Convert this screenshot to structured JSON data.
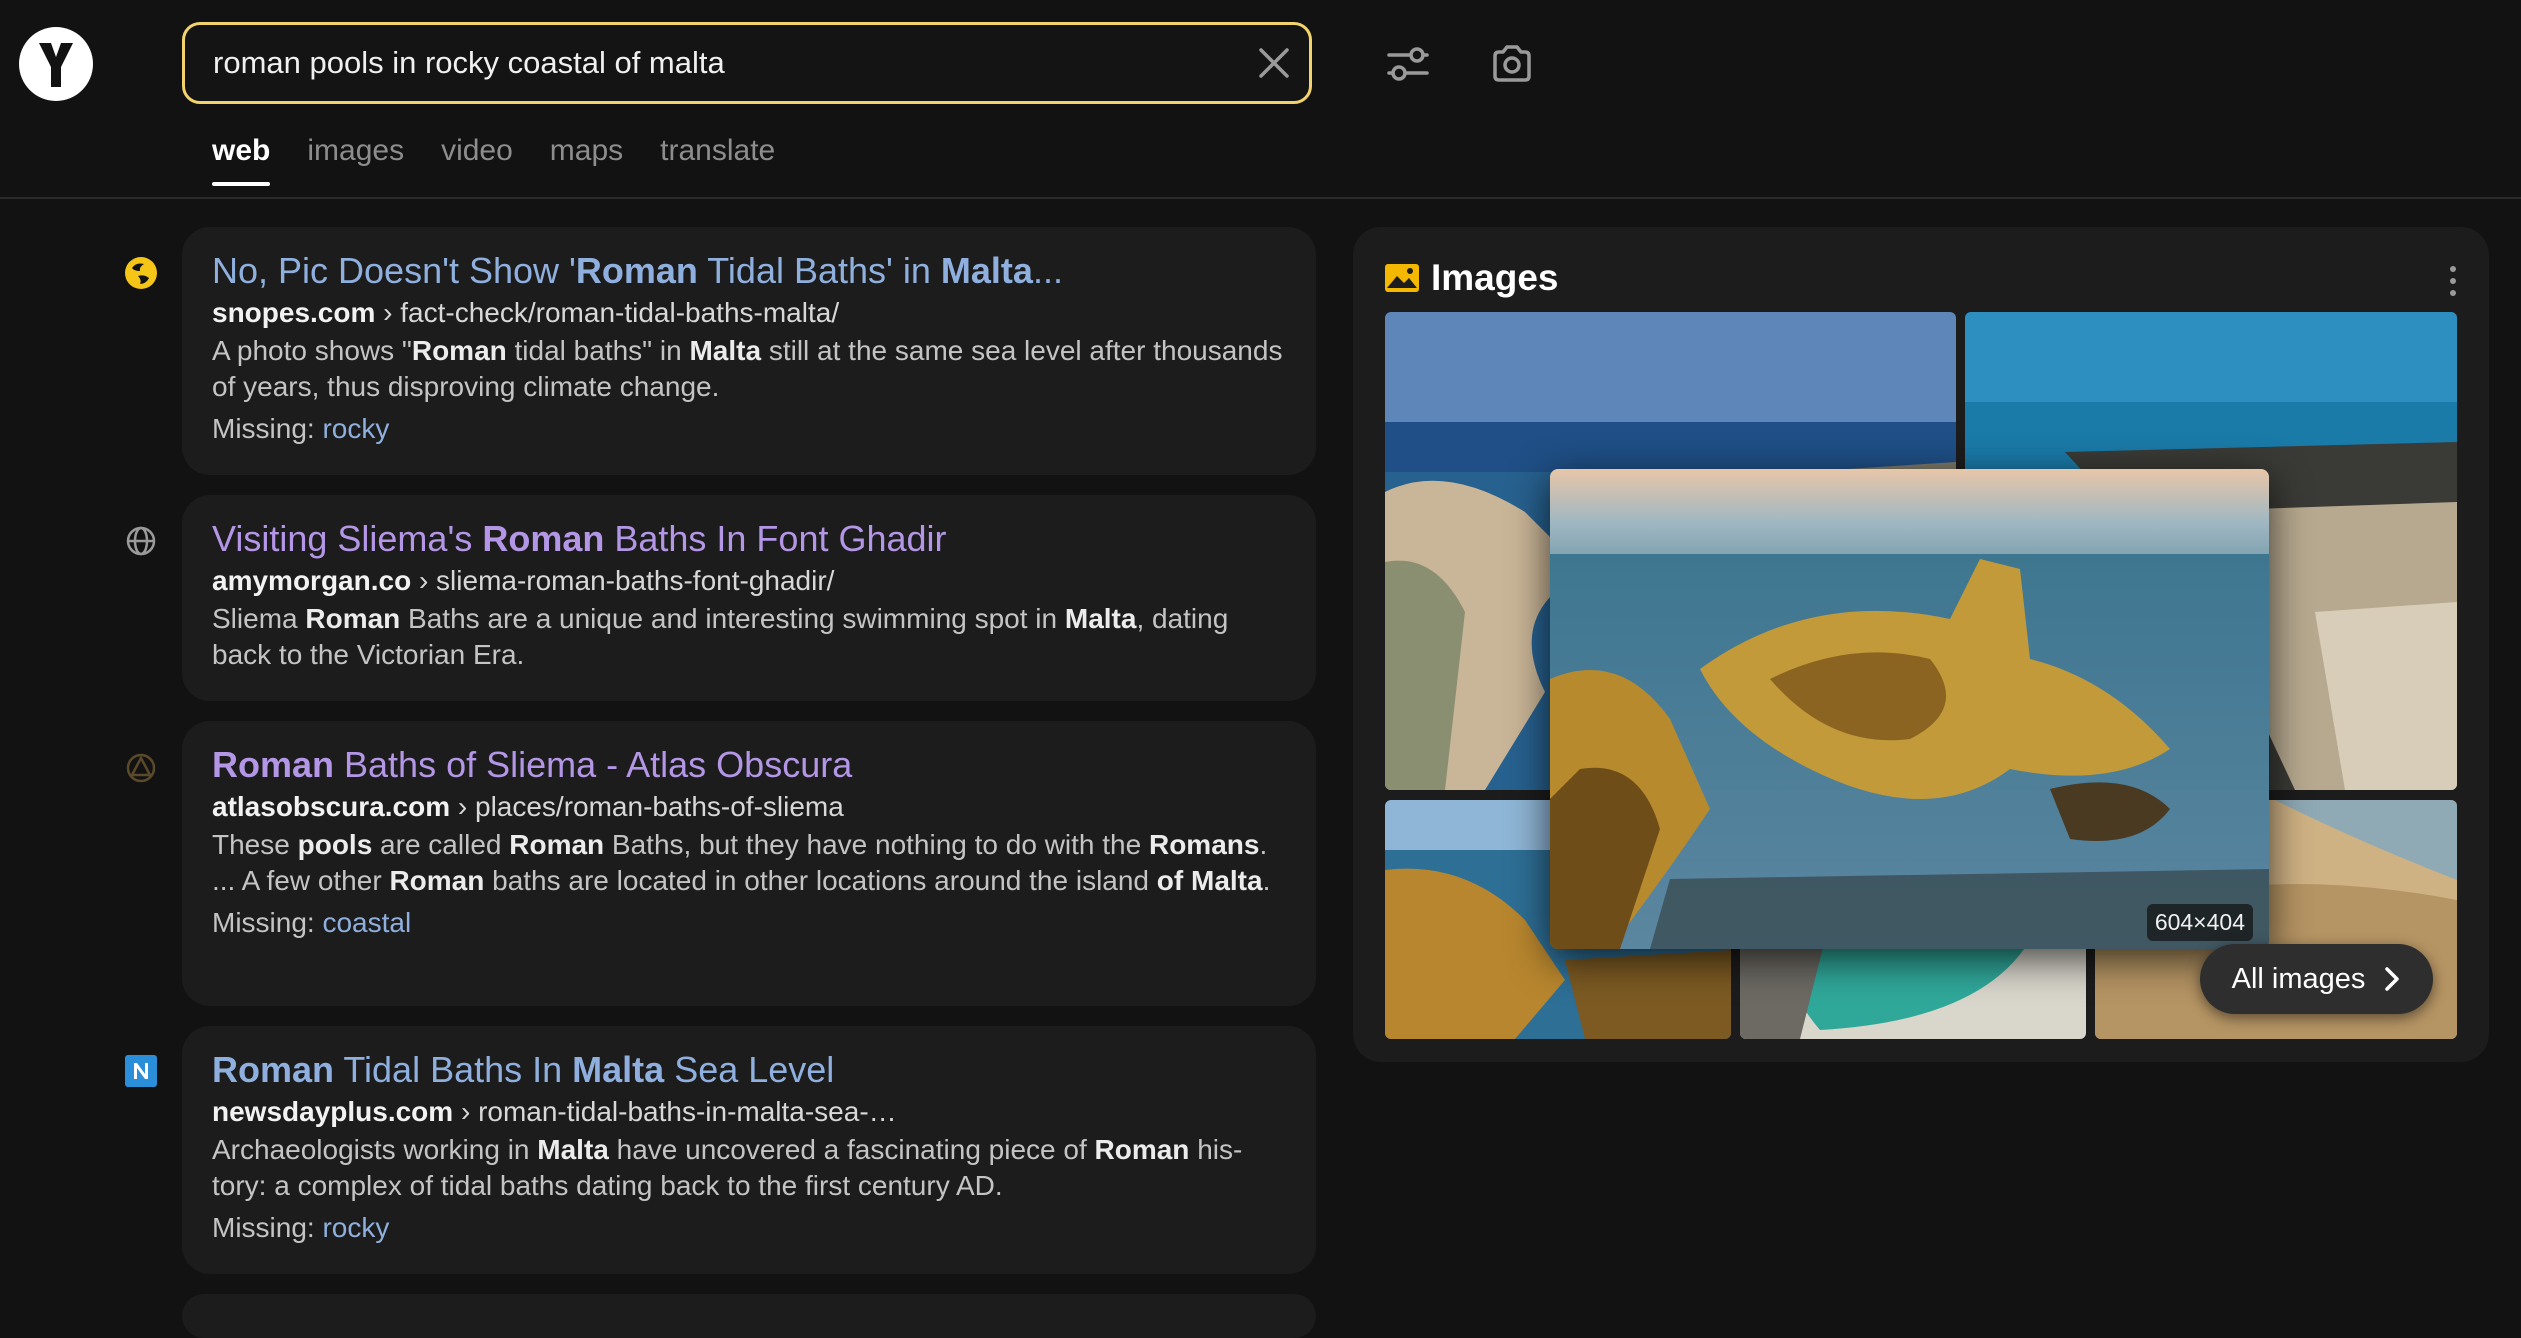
{
  "search": {
    "query": "roman pools in rocky coastal of malta"
  },
  "header": {
    "logo_letter": "Y"
  },
  "tabs": [
    "web",
    "images",
    "video",
    "maps",
    "translate"
  ],
  "results": [
    {
      "title": [
        [
          "No, Pic Doesn't Show '",
          false
        ],
        [
          "Roman",
          true
        ],
        [
          " Tidal Baths' in ",
          false
        ],
        [
          "Malta",
          true
        ],
        [
          "...",
          false
        ]
      ],
      "domain": "snopes.com",
      "path": " › fact-check/roman-tidal-baths-malta/",
      "snippet": [
        [
          "A photo shows \"",
          false
        ],
        [
          "Roman",
          true
        ],
        [
          " tidal baths\" in ",
          false
        ],
        [
          "Malta",
          true
        ],
        [
          " still at the same sea level after thousands of years, thus disproving climate change.",
          false
        ]
      ],
      "missing_label": "Missing: ",
      "missing": "rocky",
      "visited": false
    },
    {
      "title": [
        [
          "Visiting Sliema's ",
          false
        ],
        [
          "Roman",
          true
        ],
        [
          " Baths In Font Ghadir",
          false
        ]
      ],
      "domain": "amymorgan.co",
      "path": " › sliema-roman-baths-font-ghadir/",
      "snippet": [
        [
          "Sliema ",
          false
        ],
        [
          "Roman",
          true
        ],
        [
          " Baths are a unique and interesting swimming spot in ",
          false
        ],
        [
          "Malta",
          true
        ],
        [
          ", dating back to the Victorian Era.",
          false
        ]
      ],
      "missing_label": "",
      "missing": "",
      "visited": true
    },
    {
      "title": [
        [
          "Roman",
          true
        ],
        [
          " Baths of Sliema - Atlas Obscura",
          false
        ]
      ],
      "domain": "atlasobscura.com",
      "path": " › places/roman-baths-of-sliema",
      "snippet": [
        [
          "These ",
          false
        ],
        [
          "pools",
          true
        ],
        [
          " are called ",
          false
        ],
        [
          "Roman",
          true
        ],
        [
          " Baths, but they have nothing to do with the ",
          false
        ],
        [
          "Romans",
          true
        ],
        [
          ". ... A few other ",
          false
        ],
        [
          "Roman",
          true
        ],
        [
          " baths are located in other locations around the island ",
          false
        ],
        [
          "of Malta",
          true
        ],
        [
          ".",
          false
        ]
      ],
      "missing_label": "Missing: ",
      "missing": "coastal",
      "visited": true
    },
    {
      "title": [
        [
          "Roman",
          true
        ],
        [
          " Tidal Baths In ",
          false
        ],
        [
          "Malta",
          true
        ],
        [
          " Sea Level",
          false
        ]
      ],
      "domain": "newsdayplus.com",
      "path": " › roman-tidal-baths-in-malta-sea-…",
      "snippet": [
        [
          "Archaeologists working in ",
          false
        ],
        [
          "Malta",
          true
        ],
        [
          " have uncovered a fascinating piece of ",
          false
        ],
        [
          "Roman",
          true
        ],
        [
          " his-tory: a complex of tidal baths dating back to the first century AD.",
          false
        ]
      ],
      "missing_label": "Missing: ",
      "missing": "rocky",
      "visited": false
    }
  ],
  "images_panel": {
    "title": "Images",
    "preview_dimensions": "604×404",
    "all_images_label": "All images"
  },
  "colors": {
    "accent_border": "#f3d36b",
    "link_blue": "#8fb0de",
    "link_visited": "#b496e6",
    "background": "#121212",
    "card": "#1c1c1c"
  }
}
